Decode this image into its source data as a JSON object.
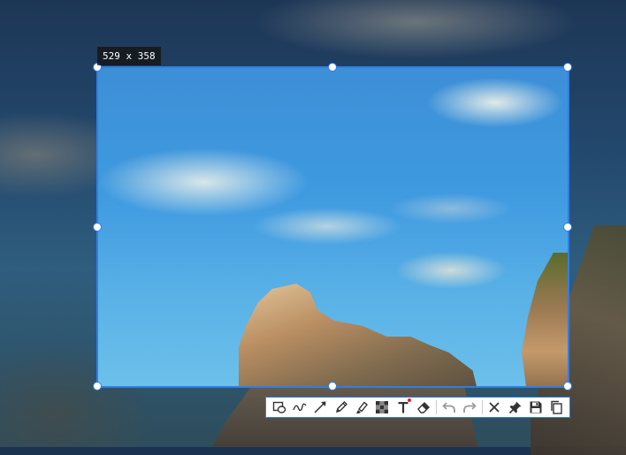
{
  "capture": {
    "size_label": "529 x 358"
  },
  "toolbar": {
    "tools": [
      {
        "icon": "rectangle-ellipse-icon"
      },
      {
        "icon": "freehand-curve-icon"
      },
      {
        "icon": "arrow-icon"
      },
      {
        "icon": "pencil-icon"
      },
      {
        "icon": "highlighter-icon"
      },
      {
        "icon": "mosaic-icon"
      },
      {
        "icon": "text-icon",
        "active_indicator": true
      },
      {
        "icon": "eraser-icon"
      },
      {
        "icon": "undo-icon"
      },
      {
        "icon": "redo-icon"
      },
      {
        "icon": "close-icon"
      },
      {
        "icon": "pin-icon"
      },
      {
        "icon": "save-icon"
      },
      {
        "icon": "copy-icon"
      }
    ]
  },
  "colors": {
    "accent": "#2f7ee6",
    "indicator": "#e02020",
    "icon": "#333333",
    "icon_disabled": "#999999"
  }
}
